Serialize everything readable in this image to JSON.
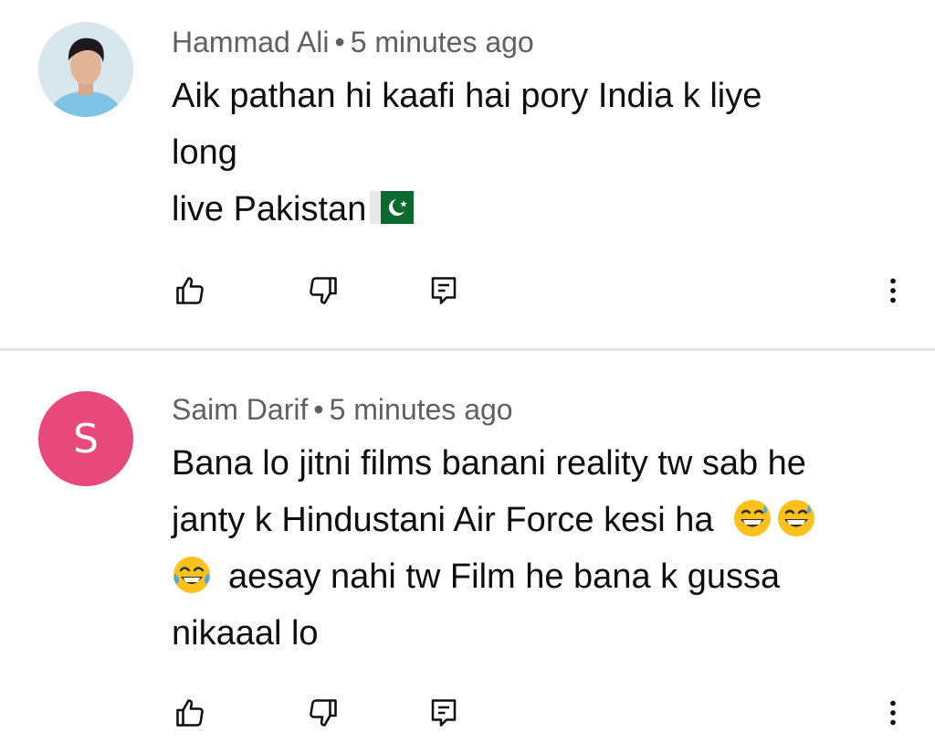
{
  "comments": [
    {
      "author": "Hammad Ali",
      "separator": "•",
      "time": "5 minutes ago",
      "lines": [
        "Aik pathan hi kaafi hai pory India k liye",
        "long",
        "live Pakistan"
      ],
      "avatar_type": "photo"
    },
    {
      "author": "Saim Darif",
      "separator": "•",
      "time": "5 minutes ago",
      "avatar_letter": "S",
      "avatar_color": "#e8497c",
      "lines": [
        "Bana lo jitni films banani reality tw sab he",
        "janty k Hindustani Air Force kesi ha",
        "aesay nahi tw Film he bana k gussa",
        "nikaaal lo"
      ]
    }
  ],
  "icons": {
    "like": "thumbs-up-icon",
    "dislike": "thumbs-down-icon",
    "reply": "reply-comment-icon",
    "more": "more-vertical-icon"
  },
  "colors": {
    "meta_text": "#606060",
    "body_text": "#0f0f0f",
    "divider": "#e5e5e5"
  }
}
